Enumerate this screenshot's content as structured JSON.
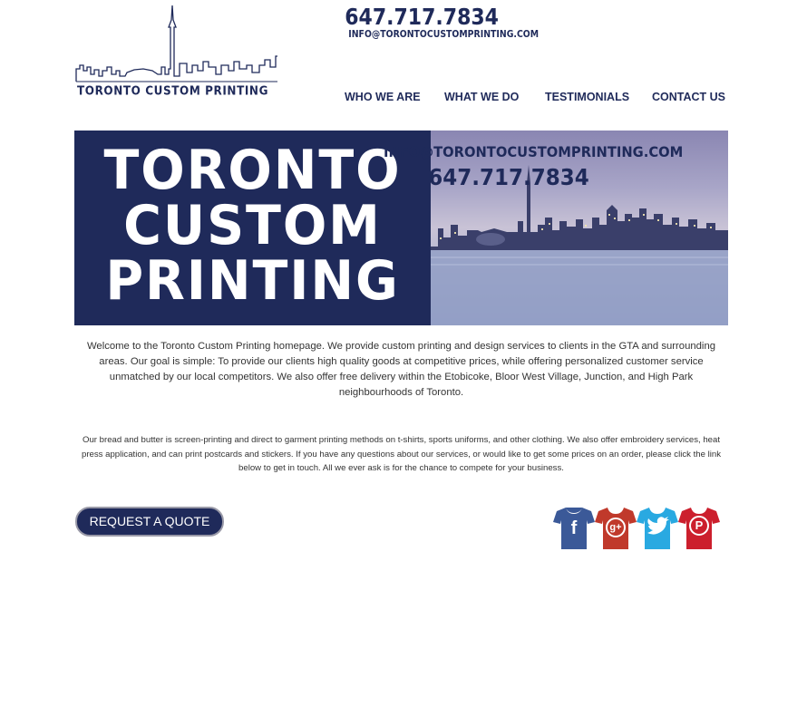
{
  "header": {
    "logo_text": "TORONTO CUSTOM PRINTING",
    "phone": "647.717.7834",
    "email": "INFO@TORONTOCUSTOMPRINTING.COM"
  },
  "nav": {
    "items": [
      {
        "label": "WHO WE ARE"
      },
      {
        "label": "WHAT WE DO"
      },
      {
        "label": "TESTIMONIALS"
      },
      {
        "label": "CONTACT US"
      }
    ]
  },
  "hero": {
    "title_lines": [
      "TORONTO",
      "CUSTOM",
      "PRINTING"
    ],
    "email": "INFO@TORONTOCUSTOMPRINTING.COM",
    "phone": "647.717.7834"
  },
  "content": {
    "intro": "Welcome to the Toronto Custom Printing homepage. We provide custom printing and design services to clients in the GTA and surrounding areas. Our goal is simple: To provide our clients high quality goods at competitive prices, while offering personalized customer service unmatched by our local competitors. We also offer free delivery within the Etobicoke, Bloor West Village, Junction, and High Park neighbourhoods of Toronto.",
    "paragraph2": "Our bread and butter is screen-printing and direct to garment printing methods on t-shirts, sports uniforms, and other clothing. We also offer embroidery services, heat press application, and can print postcards and stickers. If you have any questions about our services, or would like to get some prices on an order, please click the link below to get in touch. All we ever ask is for the chance to compete for your business."
  },
  "cta": {
    "label": "REQUEST A QUOTE"
  },
  "social": [
    {
      "icon": "facebook-tshirt-icon",
      "glyph": "f",
      "color": "#3b5998"
    },
    {
      "icon": "googleplus-tshirt-icon",
      "glyph": "g+",
      "color": "#c0392b"
    },
    {
      "icon": "twitter-tshirt-icon",
      "glyph": "t",
      "color": "#29a9e1"
    },
    {
      "icon": "pinterest-tshirt-icon",
      "glyph": "P",
      "color": "#cc1f2d"
    }
  ],
  "colors": {
    "brand_navy": "#1f2a5a",
    "text": "#333333",
    "background": "#ffffff"
  }
}
